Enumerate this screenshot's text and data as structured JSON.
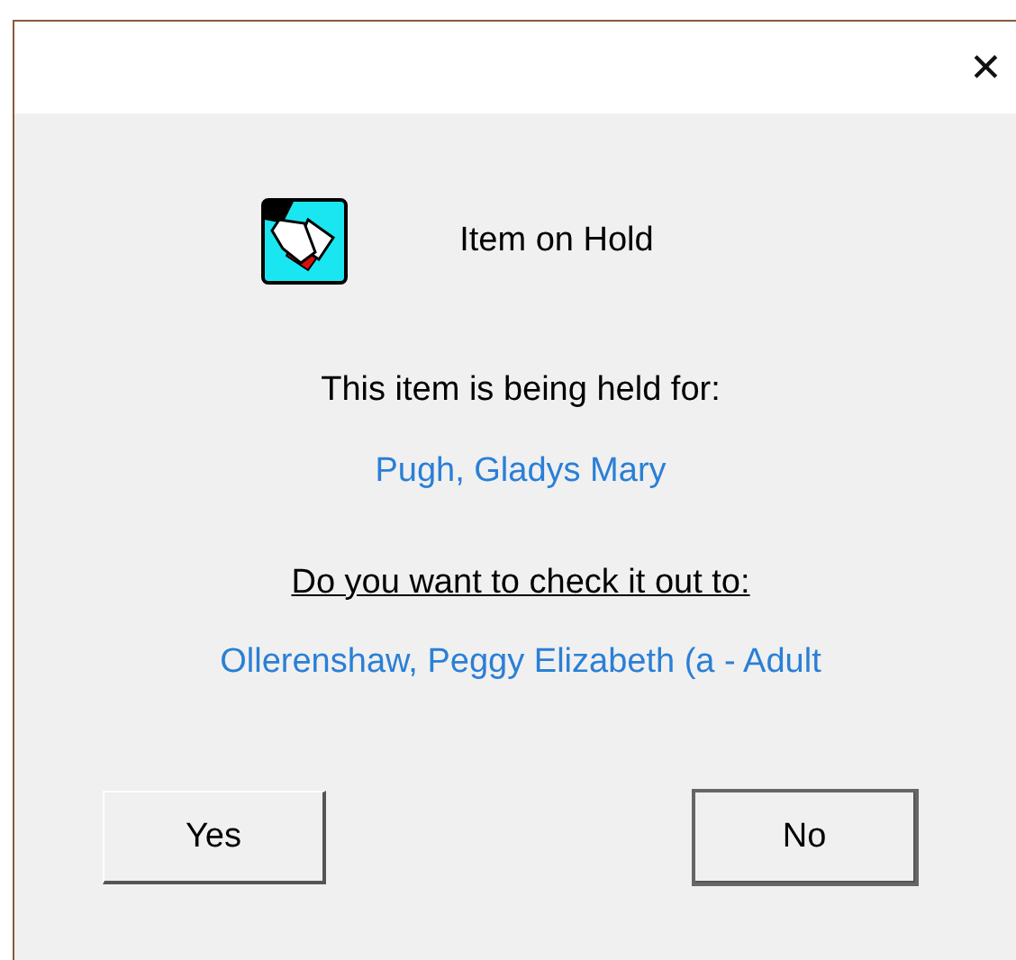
{
  "window": {
    "close_glyph": "✕"
  },
  "header": {
    "title": "Item on Hold"
  },
  "held_label": "This item is being held for:",
  "held_for": "Pugh, Gladys Mary",
  "question": "Do you want to check it out to:",
  "checkout_to": "Ollerenshaw, Peggy Elizabeth (a - Adult",
  "buttons": [
    {
      "label": "Yes",
      "default": false
    },
    {
      "label": "No",
      "default": true
    }
  ]
}
